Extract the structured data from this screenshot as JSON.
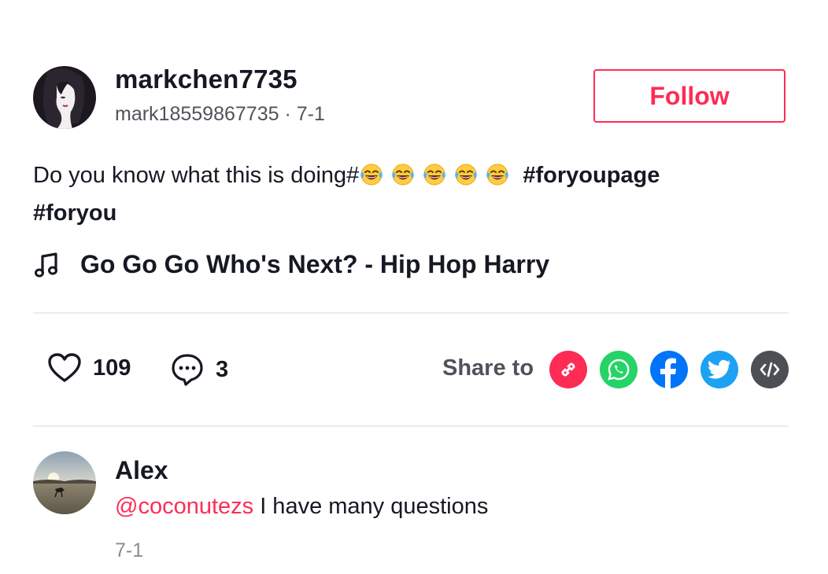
{
  "author": {
    "username": "markchen7735",
    "handle": "mark18559867735",
    "date_sep": " · ",
    "date": "7-1"
  },
  "follow_label": "Follow",
  "caption": {
    "text": "Do you know what this is doing#",
    "emoji_count": 5,
    "emoji_name": "face-with-tears-of-joy-icon",
    "tag1": "#foryoupage",
    "tag2": "#foryou"
  },
  "music": {
    "title": "Go Go Go Who's Next? - Hip Hop Harry"
  },
  "stats": {
    "likes": "109",
    "comments": "3"
  },
  "share": {
    "label": "Share to",
    "targets": [
      {
        "name": "copy-link",
        "color": "#fe2c55"
      },
      {
        "name": "whatsapp",
        "color": "#25d366"
      },
      {
        "name": "facebook",
        "color": "#0075fa"
      },
      {
        "name": "twitter",
        "color": "#1da1f2"
      },
      {
        "name": "embed",
        "color": "#4d4f56"
      }
    ]
  },
  "comment": {
    "author": "Alex",
    "mention": "@coconutezs",
    "text": " I have many questions",
    "date": "7-1"
  },
  "colors": {
    "accent": "#fe2c55",
    "text": "#161823",
    "divider": "#ececee"
  }
}
